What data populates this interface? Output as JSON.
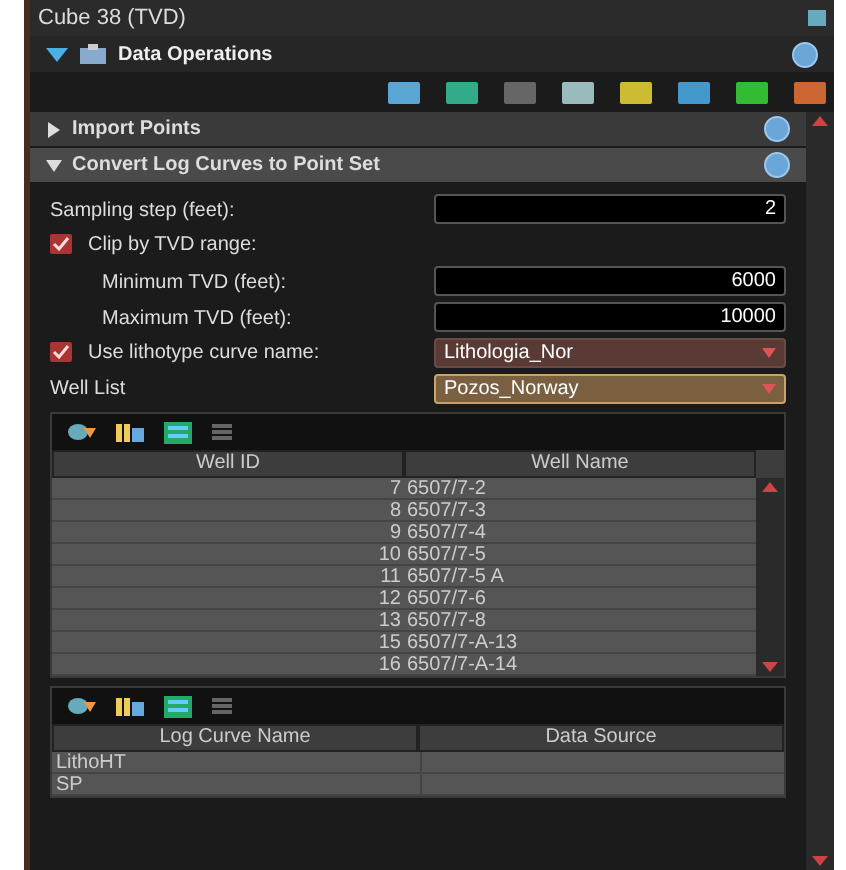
{
  "window": {
    "title": "Cube 38 (TVD)"
  },
  "panel": {
    "title": "Data Operations",
    "expanded": true
  },
  "sections": [
    {
      "title": "Import Points",
      "expanded": false
    },
    {
      "title": "Convert Log Curves to Point Set",
      "expanded": true
    }
  ],
  "fields": [
    {
      "kind": "number",
      "label": "Sampling step (feet):",
      "value": "2"
    },
    {
      "kind": "checkbox",
      "label": "Clip by TVD range:",
      "checked": true,
      "children": [
        {
          "kind": "number",
          "label": "Minimum TVD (feet):",
          "value": "6000"
        },
        {
          "kind": "number",
          "label": "Maximum TVD (feet):",
          "value": "10000"
        }
      ]
    },
    {
      "kind": "checkselect",
      "label": "Use lithotype curve name:",
      "checked": true,
      "value": "Lithologia_Nor"
    },
    {
      "kind": "select",
      "label": "Well List",
      "value": "Pozos_Norway"
    }
  ],
  "well_table": {
    "columns": [
      "Well ID",
      "Well Name"
    ],
    "rows": [
      {
        "id": "7",
        "name": "6507/7-2"
      },
      {
        "id": "8",
        "name": "6507/7-3"
      },
      {
        "id": "9",
        "name": "6507/7-4"
      },
      {
        "id": "10",
        "name": "6507/7-5"
      },
      {
        "id": "11",
        "name": "6507/7-5 A"
      },
      {
        "id": "12",
        "name": "6507/7-6"
      },
      {
        "id": "13",
        "name": "6507/7-8"
      },
      {
        "id": "15",
        "name": "6507/7-A-13"
      },
      {
        "id": "16",
        "name": "6507/7-A-14"
      }
    ]
  },
  "log_table": {
    "columns": [
      "Log Curve Name",
      "Data Source"
    ],
    "rows": [
      {
        "name": "LithoHT"
      },
      {
        "name": "SP"
      }
    ]
  }
}
